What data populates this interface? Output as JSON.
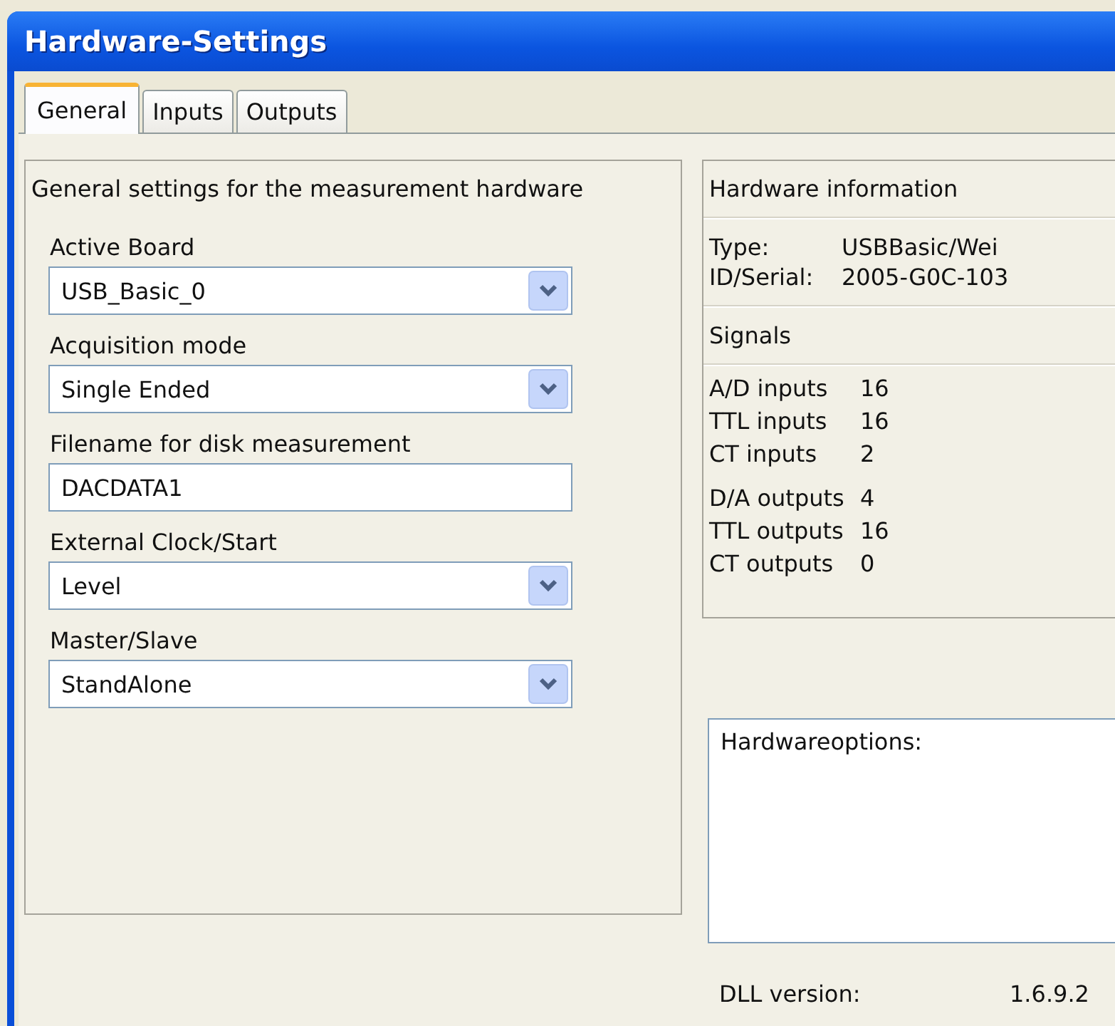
{
  "window": {
    "title": "Hardware-Settings"
  },
  "tabs": [
    {
      "label": "General",
      "selected": true
    },
    {
      "label": "Inputs",
      "selected": false
    },
    {
      "label": "Outputs",
      "selected": false
    }
  ],
  "general": {
    "heading": "General settings for the measurement hardware",
    "fields": [
      {
        "kind": "combo",
        "label": "Active Board",
        "value": "USB_Basic_0"
      },
      {
        "kind": "combo",
        "label": "Acquisition mode",
        "value": "Single Ended"
      },
      {
        "kind": "text",
        "label": "Filename for disk measurement",
        "value": "DACDATA1"
      },
      {
        "kind": "combo",
        "label": "External Clock/Start",
        "value": "Level"
      },
      {
        "kind": "combo",
        "label": "Master/Slave",
        "value": "StandAlone"
      }
    ]
  },
  "hardware_info": {
    "heading": "Hardware information",
    "rows": [
      {
        "label": "Type:",
        "value": "USBBasic/Wei"
      },
      {
        "label": "ID/Serial:",
        "value": "2005-G0C-103"
      }
    ],
    "signals_heading": "Signals",
    "signal_groups": [
      [
        {
          "label": "A/D inputs",
          "value": "16"
        },
        {
          "label": "TTL inputs",
          "value": "16"
        },
        {
          "label": "CT inputs",
          "value": "2"
        }
      ],
      [
        {
          "label": "D/A outputs",
          "value": "4"
        },
        {
          "label": "TTL outputs",
          "value": "16"
        },
        {
          "label": "CT outputs",
          "value": "0"
        }
      ]
    ],
    "options_text": "Hardwareoptions:",
    "dll_label": "DLL version:",
    "dll_value": "1.6.9.2"
  }
}
